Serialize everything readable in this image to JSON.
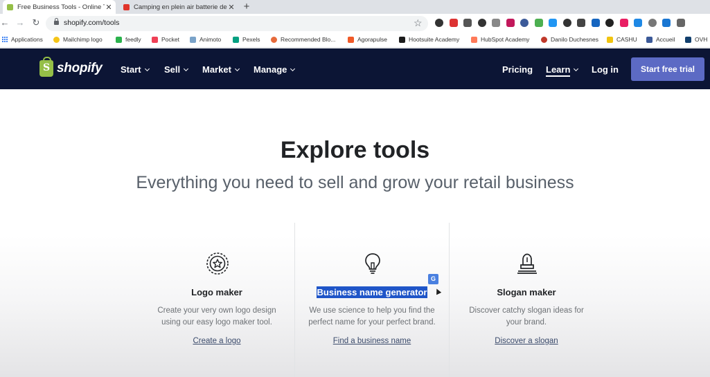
{
  "browser": {
    "tabs": [
      {
        "title": "Free Business Tools - Online Tools",
        "favicon_color": "#95bf47",
        "close": "✕"
      },
      {
        "title": "Camping en plein air batterie de",
        "favicon_color": "#e0342a",
        "close": "✕"
      }
    ],
    "new_tab": "+",
    "url": "shopify.com/tools",
    "back": "←",
    "forward": "→",
    "reload": "↻",
    "star": "☆",
    "extension_colors": [
      "#333",
      "#d33",
      "#555",
      "#333",
      "#888",
      "#c2185b",
      "#3c5a99",
      "#4caf50",
      "#2196f3",
      "#333",
      "#444",
      "#1565c0",
      "#222",
      "#e91e63",
      "#1e88e5",
      "#777",
      "#1976d2",
      "#666"
    ],
    "bookmarks": [
      {
        "label": "Applications",
        "icon": "apps-icon"
      },
      {
        "label": "Mailchimp logo",
        "color": "#f5c518"
      },
      {
        "label": "feedly",
        "color": "#2bb24c"
      },
      {
        "label": "Pocket",
        "color": "#ef4056"
      },
      {
        "label": "Animoto",
        "color": "#7aa3c9"
      },
      {
        "label": "Pexels",
        "color": "#05a081"
      },
      {
        "label": "Recommended Blo...",
        "color": "#e66a3b"
      },
      {
        "label": "Agorapulse",
        "color": "#f05a28"
      },
      {
        "label": "Hootsuite Academy",
        "color": "#1c1c1c"
      },
      {
        "label": "HubSpot Academy",
        "color": "#ff7a59"
      },
      {
        "label": "Danilo Duchesnes",
        "color": "#c0392b"
      },
      {
        "label": "CASHU",
        "color": "#f1c40f"
      },
      {
        "label": "Accueil",
        "color": "#3b5998"
      },
      {
        "label": "OVH",
        "color": "#123f6d"
      }
    ]
  },
  "site": {
    "logo_text": "shopify",
    "nav": [
      {
        "label": "Start"
      },
      {
        "label": "Sell"
      },
      {
        "label": "Market"
      },
      {
        "label": "Manage"
      }
    ],
    "right": {
      "pricing": "Pricing",
      "learn": "Learn",
      "login": "Log in",
      "cta": "Start free trial"
    },
    "colors": {
      "nav_bg": "#0c1535",
      "brand_green": "#95bf47",
      "cta_bg": "#5c6ac4"
    }
  },
  "hero": {
    "title": "Explore tools",
    "subtitle": "Everything you need to sell and grow your retail business"
  },
  "cards": [
    {
      "title": "Logo maker",
      "desc": [
        "Create your very own logo design",
        "using our easy logo maker tool."
      ],
      "link": "Create a logo",
      "icon": "badge-star-icon"
    },
    {
      "title": "Business name generator",
      "desc": [
        "We use science to help you find the",
        "perfect name for your perfect brand."
      ],
      "link": "Find a business name",
      "icon": "lightbulb-icon",
      "selected": true
    },
    {
      "title": "Slogan maker",
      "desc": [
        "Discover catchy slogan ideas for",
        "your brand."
      ],
      "link": "Discover a slogan",
      "icon": "lamp-icon"
    }
  ],
  "translate_badge": "G"
}
